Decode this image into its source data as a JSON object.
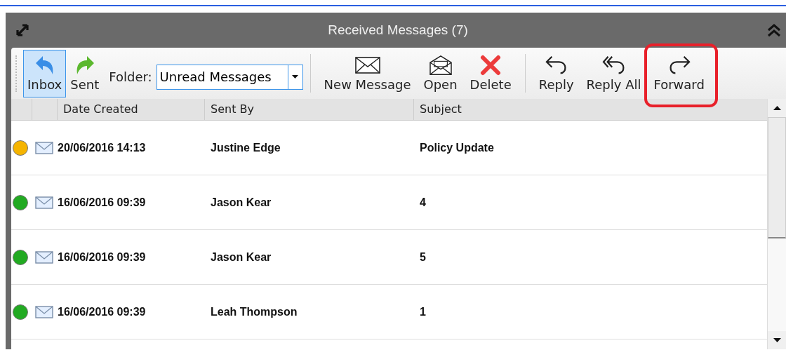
{
  "panel": {
    "title": "Received Messages (7)"
  },
  "toolbar": {
    "nav": [
      {
        "label": "Inbox",
        "kind": "inbox",
        "selected": true
      },
      {
        "label": "Sent",
        "kind": "sent",
        "selected": false
      }
    ],
    "folder": {
      "label": "Folder:",
      "value": "Unread Messages"
    },
    "groups": [
      [
        {
          "label": "New Message",
          "kind": "new",
          "highlighted": false
        },
        {
          "label": "Open",
          "kind": "open",
          "highlighted": false
        },
        {
          "label": "Delete",
          "kind": "delete",
          "highlighted": false
        }
      ],
      [
        {
          "label": "Reply",
          "kind": "reply",
          "highlighted": false
        },
        {
          "label": "Reply All",
          "kind": "reply-all",
          "highlighted": false
        },
        {
          "label": "Forward",
          "kind": "forward",
          "highlighted": true
        }
      ]
    ]
  },
  "table": {
    "columns": [
      "Date Created",
      "Sent By",
      "Subject"
    ],
    "rows": [
      {
        "color": "#f5b400",
        "unread": true,
        "cells": [
          "20/06/2016 14:13",
          "Justine Edge",
          "Policy Update"
        ]
      },
      {
        "color": "#22aa22",
        "unread": true,
        "cells": [
          "16/06/2016 09:39",
          "Jason Kear",
          "4"
        ]
      },
      {
        "color": "#22aa22",
        "unread": true,
        "cells": [
          "16/06/2016 09:39",
          "Jason Kear",
          "5"
        ]
      },
      {
        "color": "#22aa22",
        "unread": true,
        "cells": [
          "16/06/2016 09:39",
          "Leah Thompson",
          "1"
        ]
      }
    ]
  }
}
